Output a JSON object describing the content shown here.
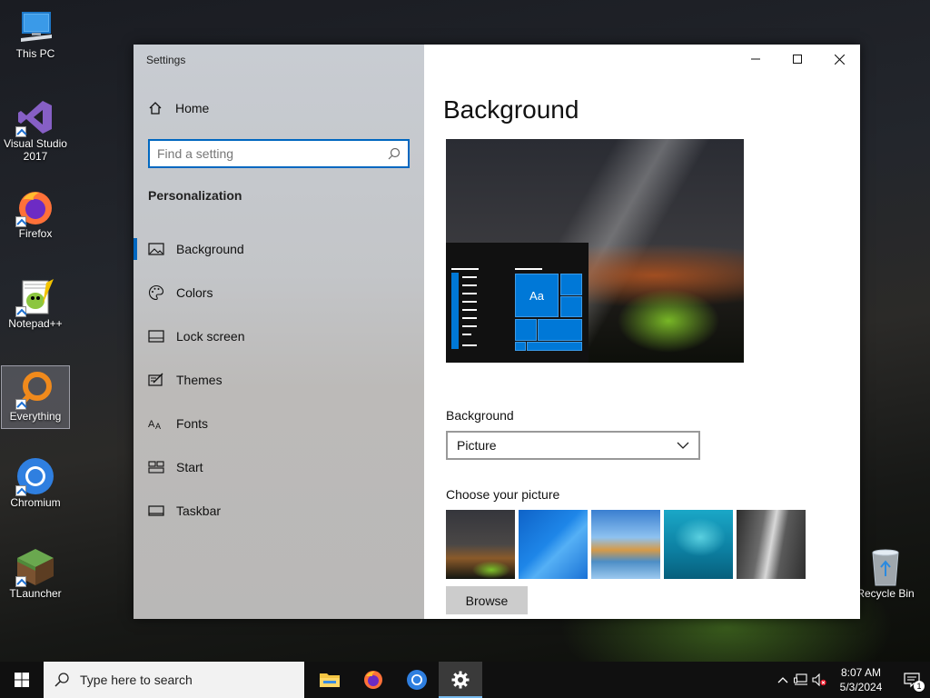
{
  "desktop": {
    "icons": [
      {
        "label": "This PC"
      },
      {
        "label": "Visual Studio\n2017"
      },
      {
        "label": "Firefox"
      },
      {
        "label": "Notepad++"
      },
      {
        "label": "Everything"
      },
      {
        "label": "Chromium"
      },
      {
        "label": "TLauncher"
      },
      {
        "label": "Recycle Bin"
      }
    ]
  },
  "window": {
    "app_title": "Settings",
    "nav": {
      "home_label": "Home",
      "search_placeholder": "Find a setting",
      "section_title": "Personalization",
      "items": [
        {
          "label": "Background",
          "icon": "picture-icon",
          "active": true
        },
        {
          "label": "Colors",
          "icon": "palette-icon"
        },
        {
          "label": "Lock screen",
          "icon": "lock-screen-icon"
        },
        {
          "label": "Themes",
          "icon": "themes-icon"
        },
        {
          "label": "Fonts",
          "icon": "fonts-icon"
        },
        {
          "label": "Start",
          "icon": "start-icon"
        },
        {
          "label": "Taskbar",
          "icon": "taskbar-icon"
        }
      ]
    },
    "content": {
      "page_title": "Background",
      "preview_tile_text": "Aa",
      "background_label": "Background",
      "background_value": "Picture",
      "choose_label": "Choose your picture",
      "browse_label": "Browse"
    }
  },
  "taskbar": {
    "search_placeholder": "Type here to search",
    "apps": [
      "file-explorer-icon",
      "firefox-icon",
      "chromium-icon",
      "settings-icon"
    ],
    "clock_time": "8:07 AM",
    "clock_date": "5/3/2024",
    "notification_count": "1"
  },
  "colors": {
    "accent": "#0067c0",
    "tile_blue": "#0078d7"
  }
}
